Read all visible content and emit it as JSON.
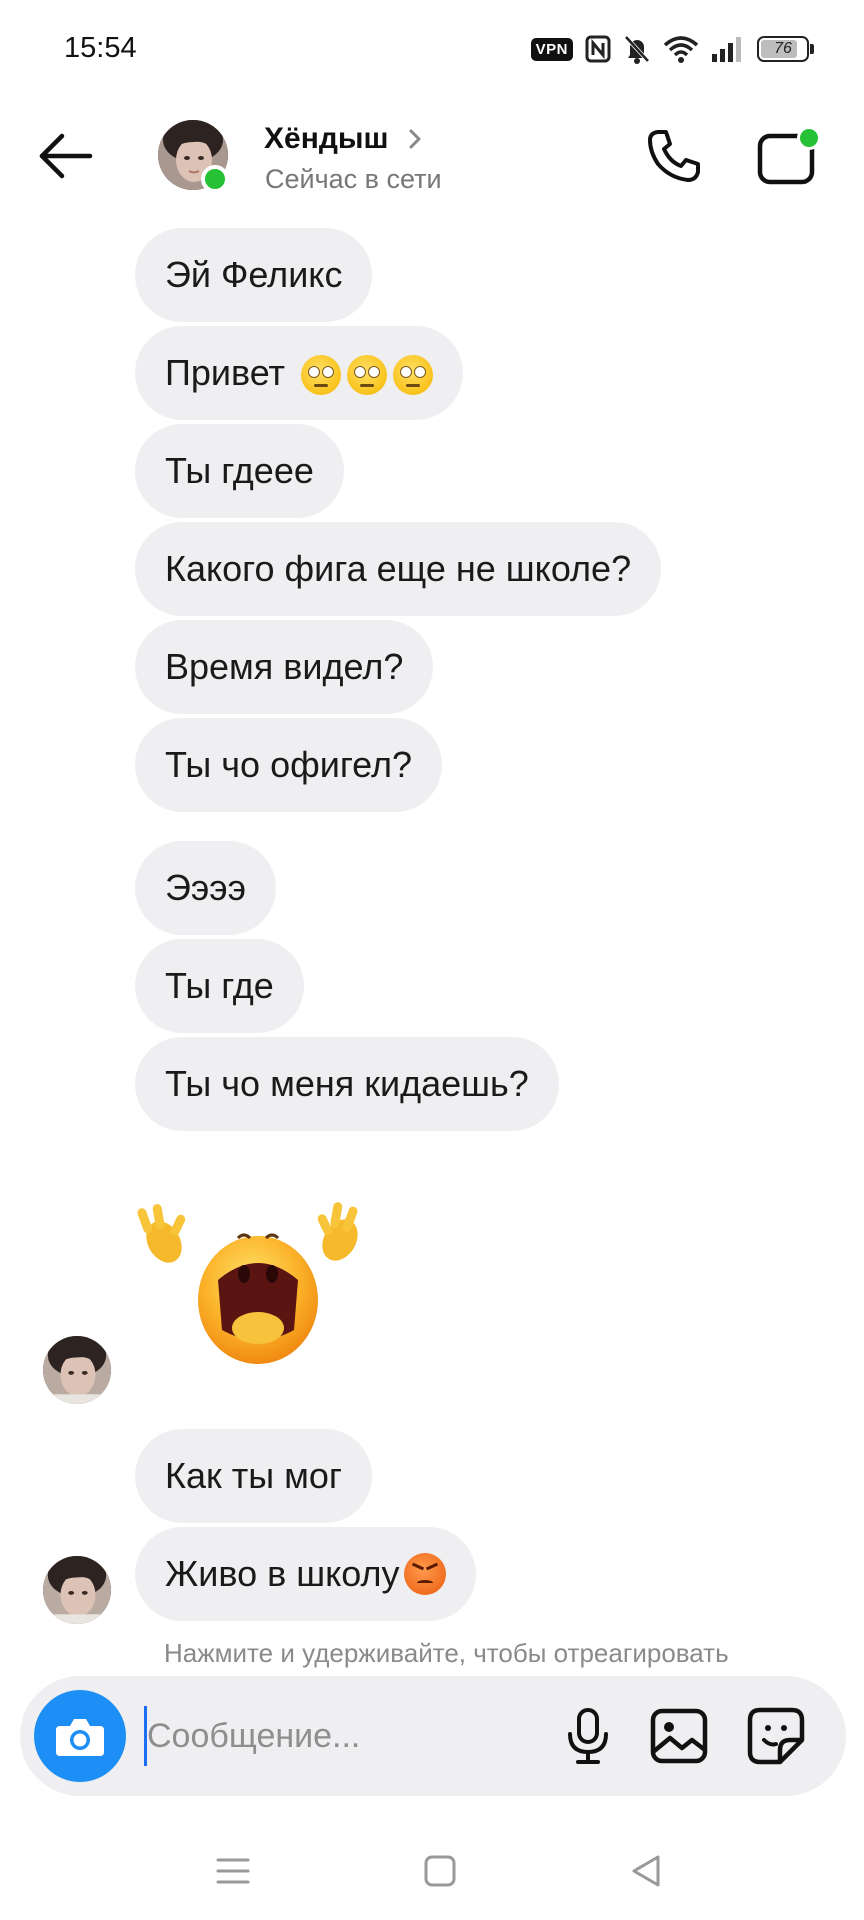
{
  "status_bar": {
    "time": "15:54",
    "vpn_label": "VPN",
    "battery": "76",
    "icons": [
      "vpn-icon",
      "nfc-icon",
      "muted-bell-icon",
      "wifi-icon",
      "signal-icon",
      "battery-icon"
    ]
  },
  "header": {
    "contact_name": "Хёндыш",
    "status": "Сейчас в сети",
    "online_color": "#26c135",
    "icons": [
      "back-arrow-icon",
      "chevron-right-icon",
      "phone-icon",
      "video-call-icon"
    ]
  },
  "messages": [
    {
      "text": "Эй Феликс"
    },
    {
      "text": "Привет",
      "emoji": "🙄🙄🙄"
    },
    {
      "text": "Ты гдеее"
    },
    {
      "text": "Какого фига еще не школе?"
    },
    {
      "text": "Время видел?"
    },
    {
      "text": "Ты чо офигел?"
    },
    {
      "text": "Ээээ"
    },
    {
      "text": "Ты где"
    },
    {
      "text": "Ты чо меня кидаешь?"
    },
    {
      "sticker": "crying-emoji-sticker"
    },
    {
      "text": "Как ты мог"
    },
    {
      "text": "Живо в школу",
      "emoji": "😡"
    }
  ],
  "hint": "Нажмите и удерживайте, чтобы отреагировать",
  "composer": {
    "placeholder": "Сообщение...",
    "accent_color": "#1c8ef5",
    "icons": [
      "camera-icon",
      "microphone-icon",
      "gallery-icon",
      "sticker-icon"
    ]
  },
  "navbar": {
    "icons": [
      "menu-icon",
      "home-icon",
      "back-icon"
    ]
  },
  "colors": {
    "bubble_bg": "#efeef1",
    "background": "#ffffff"
  }
}
